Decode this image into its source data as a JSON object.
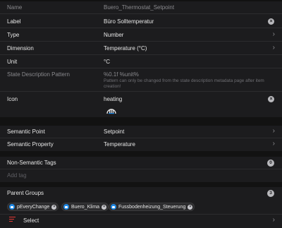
{
  "form": {
    "name": {
      "label": "Name",
      "value": "Buero_Thermostat_Setpoint"
    },
    "item_label": {
      "label": "Label",
      "value": "Büro Solltemperatur"
    },
    "type": {
      "label": "Type",
      "value": "Number"
    },
    "dimension": {
      "label": "Dimension",
      "value": "Temperature (°C)"
    },
    "unit": {
      "label": "Unit",
      "value": "°C"
    },
    "pattern": {
      "label": "State Description Pattern",
      "value": "%0.1f %unit%",
      "note": "Pattern can only be changed from the state description metadata page after item creation!"
    },
    "icon": {
      "label": "Icon",
      "value": "heating",
      "icon_name": "heating-radiator-icon"
    }
  },
  "semantics": {
    "point": {
      "label": "Semantic Point",
      "value": "Setpoint"
    },
    "property": {
      "label": "Semantic Property",
      "value": "Temperature"
    }
  },
  "tags": {
    "label": "Non-Semantic Tags",
    "count": "0",
    "add_placeholder": "Add tag"
  },
  "groups": {
    "label": "Parent Groups",
    "count": "3",
    "chips": [
      "pEveryChange",
      "Buero_Klima",
      "Fussbodenheizung_Steuerung"
    ],
    "select_label": "Select"
  },
  "colors": {
    "background": "#121212",
    "panel": "#1c1c1e",
    "chip_icon": "#1e88e5",
    "select_icon": "#e53935"
  }
}
